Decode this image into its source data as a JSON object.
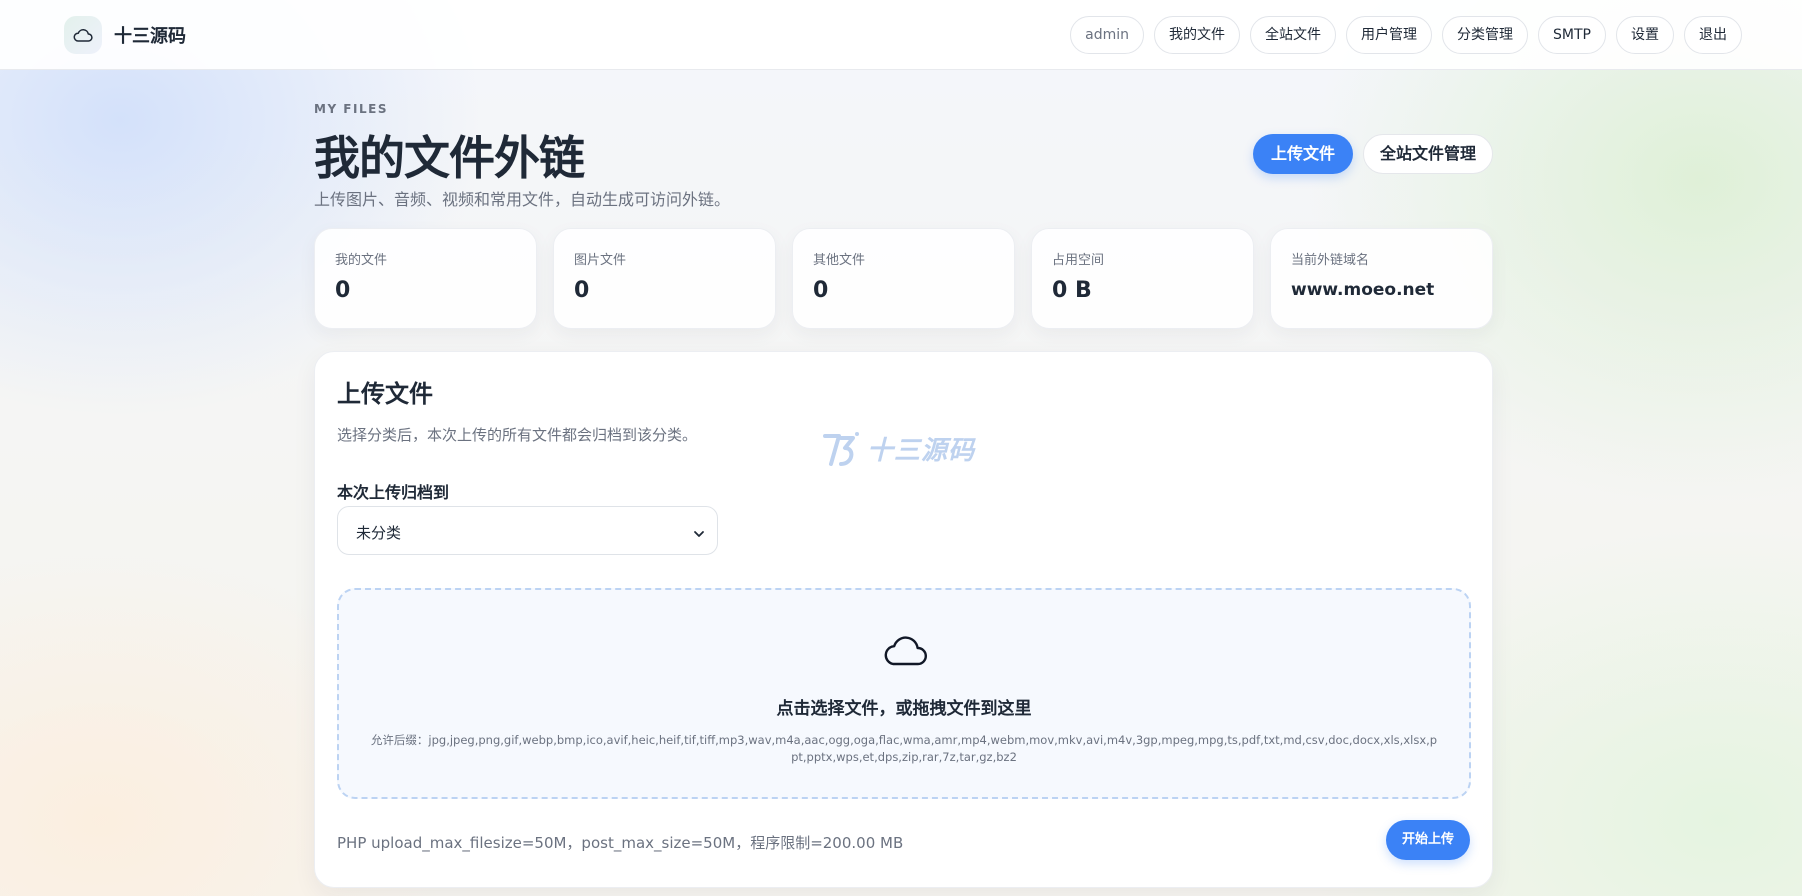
{
  "brand": {
    "name": "十三源码",
    "logo_icon": "cloud-icon"
  },
  "nav": {
    "user": "admin",
    "items": [
      "我的文件",
      "全站文件",
      "用户管理",
      "分类管理",
      "SMTP",
      "设置",
      "退出"
    ]
  },
  "header": {
    "eyebrow": "MY FILES",
    "title": "我的文件外链",
    "subtitle": "上传图片、音频、视频和常用文件，自动生成可访问外链。",
    "primary_action": "上传文件",
    "secondary_action": "全站文件管理"
  },
  "stats": [
    {
      "label": "我的文件",
      "value": "0"
    },
    {
      "label": "图片文件",
      "value": "0"
    },
    {
      "label": "其他文件",
      "value": "0"
    },
    {
      "label": "占用空间",
      "value": "0 B"
    },
    {
      "label": "当前外链域名",
      "value": "www.moeo.net"
    }
  ],
  "upload": {
    "title": "上传文件",
    "description": "选择分类后，本次上传的所有文件都会归档到该分类。",
    "watermark": "十三源码",
    "category_label": "本次上传归档到",
    "category_selected": "未分类",
    "dropzone_icon": "cloud-icon",
    "dropzone_title": "点击选择文件，或拖拽文件到这里",
    "allowed_ext": "允许后缀：jpg,jpeg,png,gif,webp,bmp,ico,avif,heic,heif,tif,tiff,mp3,wav,m4a,aac,ogg,oga,flac,wma,amr,mp4,webm,mov,mkv,avi,m4v,3gp,mpeg,mpg,ts,pdf,txt,md,csv,doc,docx,xls,xlsx,ppt,pptx,wps,et,dps,zip,rar,7z,tar,gz,bz2",
    "limits": "PHP upload_max_filesize=50M，post_max_size=50M，程序限制=200.00 MB",
    "start_button": "开始上传"
  },
  "colors": {
    "accent": "#3b82f6",
    "text": "#1f2937",
    "muted": "#6b7280",
    "dropzone_border": "#bcd3f3"
  }
}
